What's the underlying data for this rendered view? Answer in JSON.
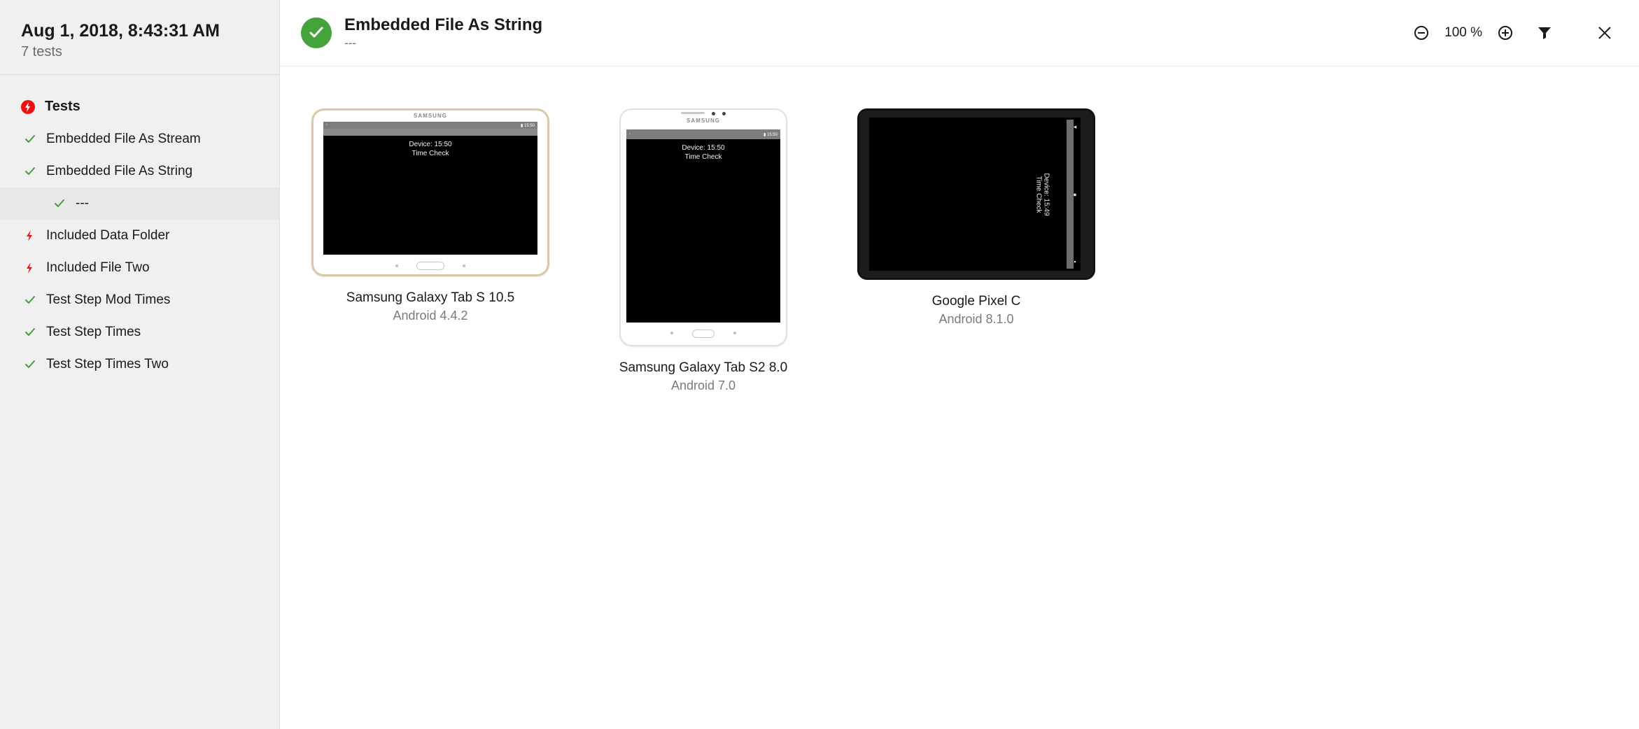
{
  "sidebar": {
    "timestamp": "Aug 1, 2018, 8:43:31 AM",
    "count_label": "7 tests",
    "group_label": "Tests",
    "items": [
      {
        "label": "Embedded File As Stream",
        "status": "pass"
      },
      {
        "label": "Embedded File As String",
        "status": "pass",
        "selected": true,
        "children": [
          {
            "label": "---",
            "status": "pass"
          }
        ]
      },
      {
        "label": "Included Data Folder",
        "status": "fail"
      },
      {
        "label": "Included File Two",
        "status": "fail"
      },
      {
        "label": "Test Step Mod Times",
        "status": "pass"
      },
      {
        "label": "Test Step Times",
        "status": "pass"
      },
      {
        "label": "Test Step Times Two",
        "status": "pass"
      }
    ]
  },
  "header": {
    "title": "Embedded File As String",
    "subtitle": "---",
    "zoom_label": "100 %"
  },
  "devices": [
    {
      "name": "Samsung Galaxy Tab S 10.5",
      "os": "Android 4.4.2",
      "form": "landscape",
      "brand": "SAMSUNG",
      "screen_line1": "Device: 15:50",
      "screen_line2": "Time Check"
    },
    {
      "name": "Samsung Galaxy Tab S2 8.0",
      "os": "Android 7.0",
      "form": "portrait",
      "brand": "SAMSUNG",
      "screen_line1": "Device: 15:50",
      "screen_line2": "Time Check"
    },
    {
      "name": "Google Pixel C",
      "os": "Android 8.1.0",
      "form": "dark",
      "brand": "",
      "screen_line1": "Device: 15:49",
      "screen_line2": "Time Check"
    }
  ]
}
